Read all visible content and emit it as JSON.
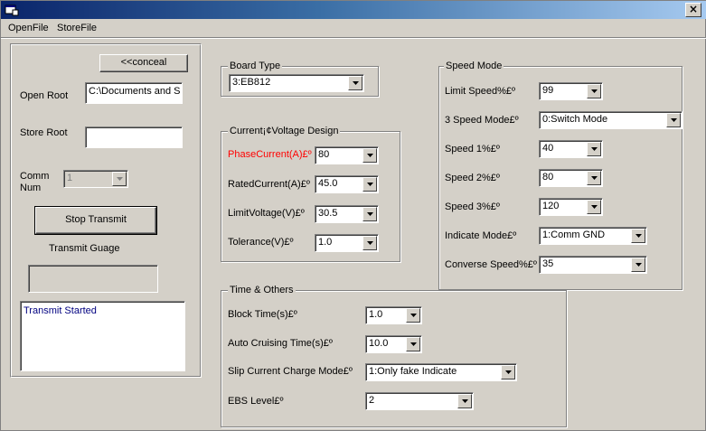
{
  "menu": {
    "open_file": "OpenFile",
    "store_file": "StoreFile"
  },
  "title_bar": {
    "close_glyph": "×"
  },
  "left": {
    "conceal_label": "<<conceal",
    "open_root_label": "Open Root",
    "open_root_value": "C:\\Documents and S",
    "store_root_label": "Store Root",
    "store_root_value": "",
    "comm_num_label_1": "Comm",
    "comm_num_label_2": "Num",
    "comm_num_value": "1",
    "stop_transmit_label": "Stop Transmit",
    "transmit_gauge_label": "Transmit Guage",
    "log_text": "Transmit Started"
  },
  "board_type": {
    "title": "Board Type",
    "value": "3:EB812"
  },
  "current_voltage": {
    "title": "Current¡¢Voltage Design",
    "phase_current_label": "PhaseCurrent(A)£º",
    "phase_current_value": "80",
    "rated_current_label": "RatedCurrent(A)£º",
    "rated_current_value": "45.0",
    "limit_voltage_label": "LimitVoltage(V)£º",
    "limit_voltage_value": "30.5",
    "tolerance_label": "Tolerance(V)£º",
    "tolerance_value": "1.0"
  },
  "speed_mode": {
    "title": "Speed Mode",
    "limit_speed_label": "Limit Speed%£º",
    "limit_speed_value": "99",
    "three_speed_mode_label": "3 Speed Mode£º",
    "three_speed_mode_value": "0:Switch Mode",
    "speed1_label": "Speed 1%£º",
    "speed1_value": "40",
    "speed2_label": "Speed 2%£º",
    "speed2_value": "80",
    "speed3_label": "Speed 3%£º",
    "speed3_value": "120",
    "indicate_mode_label": "Indicate Mode£º",
    "indicate_mode_value": "1:Comm GND",
    "converse_speed_label": "Converse Speed%£º",
    "converse_speed_value": "35"
  },
  "time_others": {
    "title": "Time & Others",
    "block_time_label": "Block Time(s)£º",
    "block_time_value": "1.0",
    "auto_cruising_label": "Auto Cruising Time(s)£º",
    "auto_cruising_value": "10.0",
    "slip_current_label": "Slip Current Charge Mode£º",
    "slip_current_value": "1:Only fake Indicate",
    "ebs_level_label": "EBS Level£º",
    "ebs_level_value": "2"
  },
  "colors": {
    "highlight_label": "#ff0000",
    "log_text": "#000080",
    "title_start": "#0a246a",
    "title_end": "#a6caf0"
  },
  "icons": {
    "app": "app-icon",
    "close": "close-icon",
    "dropdown": "dropdown-arrow-icon"
  }
}
